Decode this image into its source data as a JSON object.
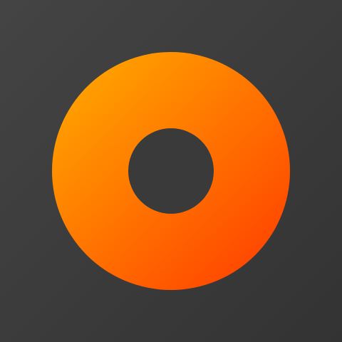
{
  "icon": {
    "name": "donut-ring-logo",
    "colors": {
      "background_start": "#444444",
      "background_end": "#333333",
      "ring_start": "#FFA000",
      "ring_end": "#FF4500",
      "hole": "#3A3A3A"
    }
  }
}
